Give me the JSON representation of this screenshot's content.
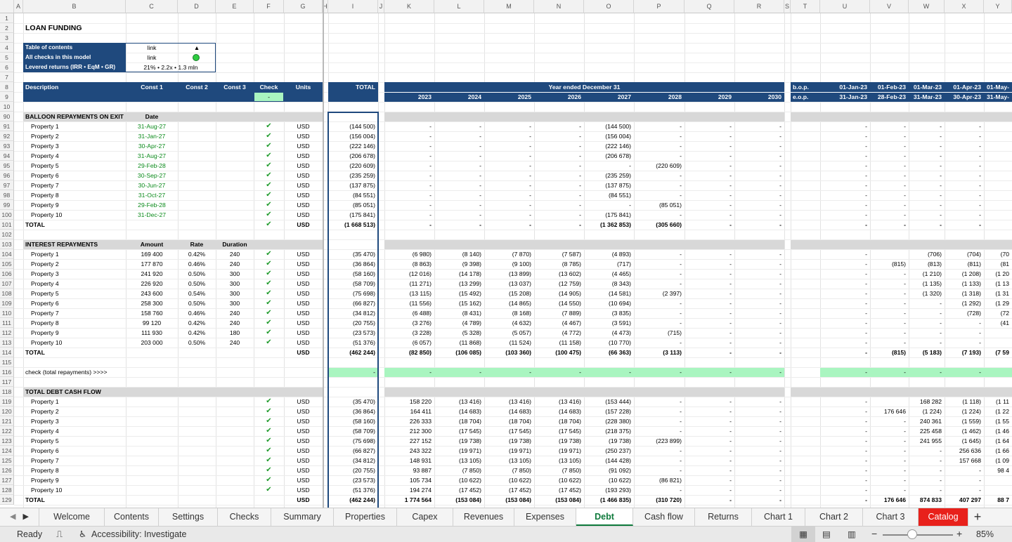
{
  "columns": [
    "A",
    "B",
    "C",
    "D",
    "E",
    "F",
    "G",
    "H",
    "I",
    "J",
    "K",
    "L",
    "M",
    "N",
    "O",
    "P",
    "Q",
    "R",
    "S",
    "T",
    "U",
    "V",
    "W",
    "X",
    "Y"
  ],
  "title": "LOAN FUNDING",
  "toc": {
    "rows": [
      {
        "label": "Table of contents",
        "value": "link",
        "extra": "▲"
      },
      {
        "label": "All checks in this model",
        "value": "link",
        "extra": ""
      },
      {
        "label": "Levered returns (IRR • EqM • GR)",
        "value": "21% • 2.2x • 1.3 mln",
        "extra": ""
      }
    ]
  },
  "header": {
    "description": "Description",
    "const1": "Const 1",
    "const2": "Const 2",
    "const3": "Const 3",
    "check": "Check",
    "units": "Units",
    "total": "TOTAL",
    "year_label": "Year ended December 31",
    "years": [
      "2023",
      "2024",
      "2025",
      "2026",
      "2027",
      "2028",
      "2029",
      "2030"
    ],
    "check_value": "-",
    "bop": "b.o.p.",
    "eop": "e.o.p.",
    "months_bop": [
      "01-Jan-23",
      "01-Feb-23",
      "01-Mar-23",
      "01-Apr-23",
      "01-May-"
    ],
    "months_eop": [
      "31-Jan-23",
      "28-Feb-23",
      "31-Mar-23",
      "30-Apr-23",
      "31-May-"
    ]
  },
  "rownums": [
    "1",
    "2",
    "3",
    "4",
    "5",
    "6",
    "7",
    "8",
    "9",
    "10",
    "90",
    "91",
    "92",
    "93",
    "94",
    "95",
    "96",
    "97",
    "98",
    "99",
    "100",
    "101",
    "102",
    "103",
    "104",
    "105",
    "106",
    "107",
    "108",
    "109",
    "110",
    "111",
    "112",
    "113",
    "114",
    "115",
    "116",
    "117",
    "118",
    "119",
    "120",
    "121",
    "122",
    "123",
    "124",
    "125",
    "126",
    "127",
    "128",
    "129"
  ],
  "balloon": {
    "heading": "BALLOON REPAYMENTS ON EXIT",
    "date_header": "Date",
    "rows": [
      {
        "name": "Property 1",
        "date": "31-Aug-27",
        "units": "USD",
        "total": "(144 500)",
        "years": [
          "-",
          "-",
          "-",
          "-",
          "(144 500)",
          "-",
          "-",
          "-"
        ],
        "months": [
          "-",
          "-",
          "-",
          "-",
          ""
        ]
      },
      {
        "name": "Property 2",
        "date": "31-Jan-27",
        "units": "USD",
        "total": "(156 004)",
        "years": [
          "-",
          "-",
          "-",
          "-",
          "(156 004)",
          "-",
          "-",
          "-"
        ],
        "months": [
          "-",
          "-",
          "-",
          "-",
          ""
        ]
      },
      {
        "name": "Property 3",
        "date": "30-Apr-27",
        "units": "USD",
        "total": "(222 146)",
        "years": [
          "-",
          "-",
          "-",
          "-",
          "(222 146)",
          "-",
          "-",
          "-"
        ],
        "months": [
          "-",
          "-",
          "-",
          "-",
          ""
        ]
      },
      {
        "name": "Property 4",
        "date": "31-Aug-27",
        "units": "USD",
        "total": "(206 678)",
        "years": [
          "-",
          "-",
          "-",
          "-",
          "(206 678)",
          "-",
          "-",
          "-"
        ],
        "months": [
          "-",
          "-",
          "-",
          "-",
          ""
        ]
      },
      {
        "name": "Property 5",
        "date": "29-Feb-28",
        "units": "USD",
        "total": "(220 609)",
        "years": [
          "-",
          "-",
          "-",
          "-",
          "-",
          "(220 609)",
          "-",
          "-"
        ],
        "months": [
          "-",
          "-",
          "-",
          "-",
          ""
        ]
      },
      {
        "name": "Property 6",
        "date": "30-Sep-27",
        "units": "USD",
        "total": "(235 259)",
        "years": [
          "-",
          "-",
          "-",
          "-",
          "(235 259)",
          "-",
          "-",
          "-"
        ],
        "months": [
          "-",
          "-",
          "-",
          "-",
          ""
        ]
      },
      {
        "name": "Property 7",
        "date": "30-Jun-27",
        "units": "USD",
        "total": "(137 875)",
        "years": [
          "-",
          "-",
          "-",
          "-",
          "(137 875)",
          "-",
          "-",
          "-"
        ],
        "months": [
          "-",
          "-",
          "-",
          "-",
          ""
        ]
      },
      {
        "name": "Property 8",
        "date": "31-Oct-27",
        "units": "USD",
        "total": "(84 551)",
        "years": [
          "-",
          "-",
          "-",
          "-",
          "(84 551)",
          "-",
          "-",
          "-"
        ],
        "months": [
          "-",
          "-",
          "-",
          "-",
          ""
        ]
      },
      {
        "name": "Property 9",
        "date": "29-Feb-28",
        "units": "USD",
        "total": "(85 051)",
        "years": [
          "-",
          "-",
          "-",
          "-",
          "-",
          "(85 051)",
          "-",
          "-"
        ],
        "months": [
          "-",
          "-",
          "-",
          "-",
          ""
        ]
      },
      {
        "name": "Property 10",
        "date": "31-Dec-27",
        "units": "USD",
        "total": "(175 841)",
        "years": [
          "-",
          "-",
          "-",
          "-",
          "(175 841)",
          "-",
          "-",
          "-"
        ],
        "months": [
          "-",
          "-",
          "-",
          "-",
          ""
        ]
      }
    ],
    "total": {
      "name": "TOTAL",
      "units": "USD",
      "total": "(1 668 513)",
      "years": [
        "-",
        "-",
        "-",
        "-",
        "(1 362 853)",
        "(305 660)",
        "-",
        "-"
      ],
      "months": [
        "-",
        "-",
        "-",
        "-",
        ""
      ]
    }
  },
  "interest": {
    "heading": "INTEREST REPAYMENTS",
    "amount_header": "Amount",
    "rate_header": "Rate",
    "duration_header": "Duration",
    "rows": [
      {
        "name": "Property 1",
        "amount": "169 400",
        "rate": "0.42%",
        "duration": "240",
        "units": "USD",
        "total": "(35 470)",
        "years": [
          "(6 980)",
          "(8 140)",
          "(7 870)",
          "(7 587)",
          "(4 893)",
          "-",
          "-",
          "-"
        ],
        "months": [
          "-",
          "",
          "(706)",
          "(704)",
          "(70"
        ]
      },
      {
        "name": "Property 2",
        "amount": "177 870",
        "rate": "0.46%",
        "duration": "240",
        "units": "USD",
        "total": "(36 864)",
        "years": [
          "(8 863)",
          "(9 398)",
          "(9 100)",
          "(8 785)",
          "(717)",
          "-",
          "-",
          "-"
        ],
        "months": [
          "-",
          "(815)",
          "(813)",
          "(811)",
          "(81"
        ]
      },
      {
        "name": "Property 3",
        "amount": "241 920",
        "rate": "0.50%",
        "duration": "300",
        "units": "USD",
        "total": "(58 160)",
        "years": [
          "(12 016)",
          "(14 178)",
          "(13 899)",
          "(13 602)",
          "(4 465)",
          "-",
          "-",
          "-"
        ],
        "months": [
          "-",
          "-",
          "(1 210)",
          "(1 208)",
          "(1 20"
        ]
      },
      {
        "name": "Property 4",
        "amount": "226 920",
        "rate": "0.50%",
        "duration": "300",
        "units": "USD",
        "total": "(58 709)",
        "years": [
          "(11 271)",
          "(13 299)",
          "(13 037)",
          "(12 759)",
          "(8 343)",
          "-",
          "-",
          "-"
        ],
        "months": [
          "-",
          "-",
          "(1 135)",
          "(1 133)",
          "(1 13"
        ]
      },
      {
        "name": "Property 5",
        "amount": "243 600",
        "rate": "0.54%",
        "duration": "300",
        "units": "USD",
        "total": "(75 698)",
        "years": [
          "(13 115)",
          "(15 492)",
          "(15 208)",
          "(14 905)",
          "(14 581)",
          "(2 397)",
          "-",
          "-"
        ],
        "months": [
          "-",
          "-",
          "(1 320)",
          "(1 318)",
          "(1 31"
        ]
      },
      {
        "name": "Property 6",
        "amount": "258 300",
        "rate": "0.50%",
        "duration": "300",
        "units": "USD",
        "total": "(66 827)",
        "years": [
          "(11 556)",
          "(15 162)",
          "(14 865)",
          "(14 550)",
          "(10 694)",
          "-",
          "-",
          "-"
        ],
        "months": [
          "-",
          "-",
          "-",
          "(1 292)",
          "(1 29"
        ]
      },
      {
        "name": "Property 7",
        "amount": "158 760",
        "rate": "0.46%",
        "duration": "240",
        "units": "USD",
        "total": "(34 812)",
        "years": [
          "(6 488)",
          "(8 431)",
          "(8 168)",
          "(7 889)",
          "(3 835)",
          "-",
          "-",
          "-"
        ],
        "months": [
          "-",
          "-",
          "-",
          "(728)",
          "(72"
        ]
      },
      {
        "name": "Property 8",
        "amount": "99 120",
        "rate": "0.42%",
        "duration": "240",
        "units": "USD",
        "total": "(20 755)",
        "years": [
          "(3 276)",
          "(4 789)",
          "(4 632)",
          "(4 467)",
          "(3 591)",
          "-",
          "-",
          "-"
        ],
        "months": [
          "-",
          "-",
          "-",
          "-",
          "(41"
        ]
      },
      {
        "name": "Property 9",
        "amount": "111 930",
        "rate": "0.42%",
        "duration": "180",
        "units": "USD",
        "total": "(23 573)",
        "years": [
          "(3 228)",
          "(5 328)",
          "(5 057)",
          "(4 772)",
          "(4 473)",
          "(715)",
          "-",
          "-"
        ],
        "months": [
          "-",
          "-",
          "-",
          "-",
          ""
        ]
      },
      {
        "name": "Property 10",
        "amount": "203 000",
        "rate": "0.50%",
        "duration": "240",
        "units": "USD",
        "total": "(51 376)",
        "years": [
          "(6 057)",
          "(11 868)",
          "(11 524)",
          "(11 158)",
          "(10 770)",
          "-",
          "-",
          "-"
        ],
        "months": [
          "-",
          "-",
          "-",
          "-",
          ""
        ]
      }
    ],
    "total": {
      "name": "TOTAL",
      "units": "USD",
      "total": "(462 244)",
      "years": [
        "(82 850)",
        "(106 085)",
        "(103 360)",
        "(100 475)",
        "(66 363)",
        "(3 113)",
        "-",
        "-"
      ],
      "months": [
        "-",
        "(815)",
        "(5 183)",
        "(7 193)",
        "(7 59"
      ]
    }
  },
  "check_row": {
    "label": "check (total repayments) >>>>",
    "total": "-",
    "years": [
      "-",
      "-",
      "-",
      "-",
      "-",
      "-",
      "-",
      "-"
    ],
    "months": [
      "-",
      "-",
      "-",
      "-",
      ""
    ]
  },
  "cashflow": {
    "heading": "TOTAL DEBT CASH FLOW",
    "rows": [
      {
        "name": "Property 1",
        "units": "USD",
        "total": "(35 470)",
        "years": [
          "158 220",
          "(13 416)",
          "(13 416)",
          "(13 416)",
          "(153 444)",
          "-",
          "-",
          "-"
        ],
        "months": [
          "-",
          "",
          "168 282",
          "(1 118)",
          "(1 11"
        ]
      },
      {
        "name": "Property 2",
        "units": "USD",
        "total": "(36 864)",
        "years": [
          "164 411",
          "(14 683)",
          "(14 683)",
          "(14 683)",
          "(157 228)",
          "-",
          "-",
          "-"
        ],
        "months": [
          "-",
          "176 646",
          "(1 224)",
          "(1 224)",
          "(1 22"
        ]
      },
      {
        "name": "Property 3",
        "units": "USD",
        "total": "(58 160)",
        "years": [
          "226 333",
          "(18 704)",
          "(18 704)",
          "(18 704)",
          "(228 380)",
          "-",
          "-",
          "-"
        ],
        "months": [
          "-",
          "-",
          "240 361",
          "(1 559)",
          "(1 55"
        ]
      },
      {
        "name": "Property 4",
        "units": "USD",
        "total": "(58 709)",
        "years": [
          "212 300",
          "(17 545)",
          "(17 545)",
          "(17 545)",
          "(218 375)",
          "-",
          "-",
          "-"
        ],
        "months": [
          "-",
          "-",
          "225 458",
          "(1 462)",
          "(1 46"
        ]
      },
      {
        "name": "Property 5",
        "units": "USD",
        "total": "(75 698)",
        "years": [
          "227 152",
          "(19 738)",
          "(19 738)",
          "(19 738)",
          "(19 738)",
          "(223 899)",
          "-",
          "-"
        ],
        "months": [
          "-",
          "-",
          "241 955",
          "(1 645)",
          "(1 64"
        ]
      },
      {
        "name": "Property 6",
        "units": "USD",
        "total": "(66 827)",
        "years": [
          "243 322",
          "(19 971)",
          "(19 971)",
          "(19 971)",
          "(250 237)",
          "-",
          "-",
          "-"
        ],
        "months": [
          "-",
          "-",
          "-",
          "256 636",
          "(1 66"
        ]
      },
      {
        "name": "Property 7",
        "units": "USD",
        "total": "(34 812)",
        "years": [
          "148 931",
          "(13 105)",
          "(13 105)",
          "(13 105)",
          "(144 428)",
          "-",
          "-",
          "-"
        ],
        "months": [
          "-",
          "-",
          "-",
          "157 668",
          "(1 09"
        ]
      },
      {
        "name": "Property 8",
        "units": "USD",
        "total": "(20 755)",
        "years": [
          "93 887",
          "(7 850)",
          "(7 850)",
          "(7 850)",
          "(91 092)",
          "-",
          "-",
          "-"
        ],
        "months": [
          "-",
          "-",
          "-",
          "-",
          "98 4"
        ]
      },
      {
        "name": "Property 9",
        "units": "USD",
        "total": "(23 573)",
        "years": [
          "105 734",
          "(10 622)",
          "(10 622)",
          "(10 622)",
          "(10 622)",
          "(86 821)",
          "-",
          "-"
        ],
        "months": [
          "-",
          "-",
          "-",
          "-",
          ""
        ]
      },
      {
        "name": "Property 10",
        "units": "USD",
        "total": "(51 376)",
        "years": [
          "194 274",
          "(17 452)",
          "(17 452)",
          "(17 452)",
          "(193 293)",
          "-",
          "-",
          "-"
        ],
        "months": [
          "-",
          "-",
          "-",
          "-",
          ""
        ]
      }
    ],
    "total": {
      "name": "TOTAL",
      "units": "USD",
      "total": "(462 244)",
      "years": [
        "1 774 564",
        "(153 084)",
        "(153 084)",
        "(153 084)",
        "(1 466 835)",
        "(310 720)",
        "-",
        "-"
      ],
      "months": [
        "-",
        "176 646",
        "874 833",
        "407 297",
        "88 7"
      ]
    }
  },
  "sheet_tabs": [
    "Welcome",
    "Contents",
    "Settings",
    "Checks",
    "Summary",
    "Properties",
    "Capex",
    "Revenues",
    "Expenses",
    "Debt",
    "Cash flow",
    "Returns",
    "Chart 1",
    "Chart 2",
    "Chart 3",
    "Catalog"
  ],
  "active_tab": "Debt",
  "status": {
    "ready": "Ready",
    "accessibility": "Accessibility: Investigate",
    "zoom": "85%"
  },
  "colors": {
    "header_band": "#1f497d",
    "active_tab": "#0f7a3c",
    "catalog_tab": "#e8211b",
    "check_fill": "#a9f5c0",
    "check_mark": "#1e9a2a",
    "date_green": "#0a8a1a"
  }
}
